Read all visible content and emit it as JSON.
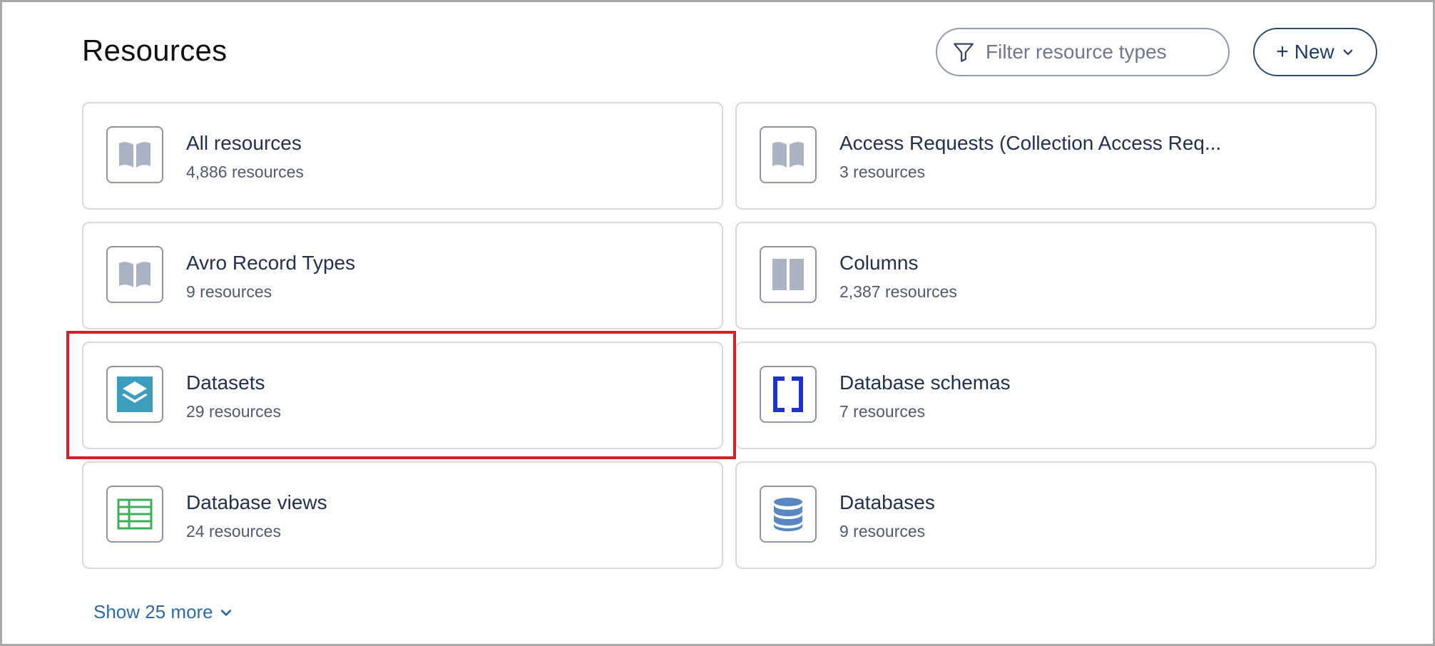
{
  "header": {
    "title": "Resources",
    "filter_placeholder": "Filter resource types",
    "new_button": {
      "plus": "+",
      "label": "New"
    }
  },
  "cards": [
    {
      "name": "All resources",
      "count": "4,886 resources",
      "icon": "book-icon"
    },
    {
      "name": "Access Requests (Collection Access Req...",
      "count": "3 resources",
      "icon": "book-icon"
    },
    {
      "name": "Avro Record Types",
      "count": "9 resources",
      "icon": "book-icon"
    },
    {
      "name": "Columns",
      "count": "2,387 resources",
      "icon": "columns-icon"
    },
    {
      "name": "Datasets",
      "count": "29 resources",
      "icon": "layers-icon",
      "highlighted": true
    },
    {
      "name": "Database schemas",
      "count": "7 resources",
      "icon": "brackets-icon"
    },
    {
      "name": "Database views",
      "count": "24 resources",
      "icon": "table-grid-icon"
    },
    {
      "name": "Databases",
      "count": "9 resources",
      "icon": "database-icon"
    }
  ],
  "show_more": "Show 25 more",
  "colors": {
    "highlight": "#d3202c",
    "link": "#2e6aa6",
    "icon_gray": "#a9b3c3",
    "dataset_teal": "#3d9dbc",
    "schema_blue": "#1f33c8",
    "view_green": "#3dae5c",
    "database_blue": "#5a86c2"
  }
}
